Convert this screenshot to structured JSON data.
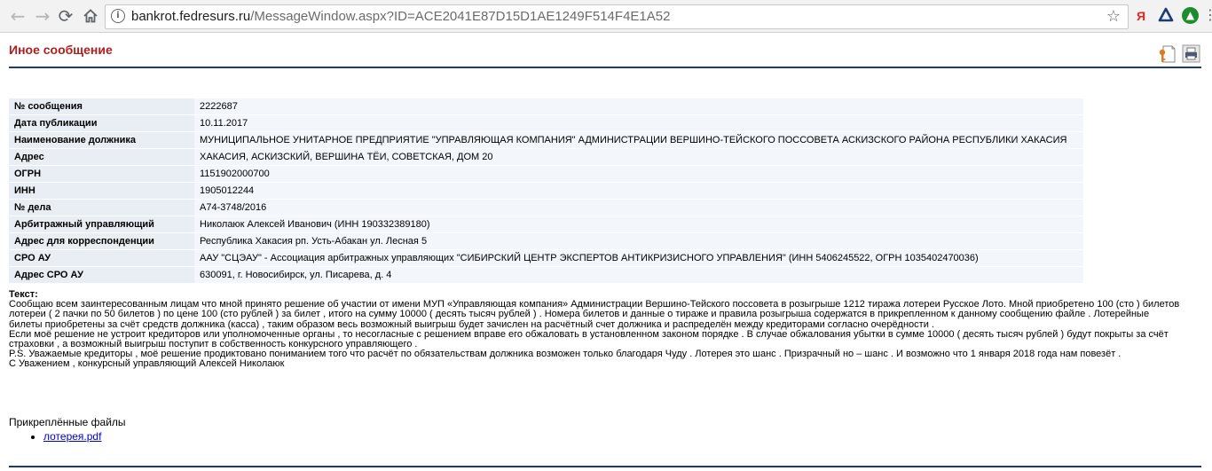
{
  "browser": {
    "back_icon": "arrow-left",
    "forward_icon": "arrow-right",
    "reload_icon": "reload",
    "home_icon": "home",
    "url_host": "bankrot.fedresurs.ru",
    "url_path": "/MessageWindow.aspx?ID=ACE2041E87D15D1AE1249F514F4E1A52",
    "extension_ya_label": "Я",
    "colors": {
      "toolbar": "#f2f2f2",
      "yandex_red": "#e52620",
      "ext_green": "#1c8c2e"
    }
  },
  "page": {
    "title": "Иное сообщение",
    "title_color": "#b01e1e",
    "rule_color": "#1e3a6e"
  },
  "details": [
    {
      "label": "№ сообщения",
      "value": "2222687"
    },
    {
      "label": "Дата публикации",
      "value": "10.11.2017"
    },
    {
      "label": "Наименование должника",
      "value": "МУНИЦИПАЛЬНОЕ УНИТАРНОЕ ПРЕДПРИЯТИЕ \"УПРАВЛЯЮЩАЯ КОМПАНИЯ\" АДМИНИСТРАЦИИ ВЕРШИНО-ТЕЙСКОГО ПОССОВЕТА АСКИЗСКОГО РАЙОНА РЕСПУБЛИКИ ХАКАСИЯ"
    },
    {
      "label": "Адрес",
      "value": "ХАКАСИЯ, АСКИЗСКИЙ, ВЕРШИНА ТЁИ, СОВЕТСКАЯ, ДОМ 20"
    },
    {
      "label": "ОГРН",
      "value": "1151902000700"
    },
    {
      "label": "ИНН",
      "value": "1905012244"
    },
    {
      "label": "№ дела",
      "value": "А74-3748/2016"
    },
    {
      "label": "Арбитражный управляющий",
      "value": "Николаюк Алексей Иванович (ИНН 190332389180)"
    },
    {
      "label": "Адрес для корреспонденции",
      "value": "Республика Хакасия рп. Усть-Абакан ул. Лесная 5"
    },
    {
      "label": "СРО АУ",
      "value": "ААУ \"СЦЭАУ\" - Ассоциация арбитражных управляющих \"СИБИРСКИЙ ЦЕНТР ЭКСПЕРТОВ АНТИКРИЗИСНОГО УПРАВЛЕНИЯ\" (ИНН 5406245522,  ОГРН 1035402470036)"
    },
    {
      "label": "Адрес СРО АУ",
      "value": "630091, г. Новосибирск, ул. Писарева, д. 4"
    }
  ],
  "message": {
    "label": "Текст:",
    "lines": [
      "Сообщаю всем заинтересованным лицам что мной принято решение об участии от имени МУП «Управляющая компания» Администрации Вершино-Тейского поссовета в розыгрыше 1212 тиража лотереи Русское Лото. Мной приобретено 100 (сто ) билетов",
      "лотереи ( 2 пачки по 50 билетов ) по цене 100 (сто рублей ) за билет , итого на сумму 10000 ( десять тысяч рублей ) . Номера билетов и данные о тираже и правила розыгрыша содержатся в прикрепленном к данному сообщению файле . Лотерейные",
      "билеты приобретены за счёт средств должника (касса) , таким образом весь возможный выигрыш будет зачислен на расчётный счет должника и распределён между кредиторами согласно очерёдности .",
      "Если моё решение не устроит кредиторов или уполномоченные органы , то несогласные с решением вправе его обжаловать в установленном законом порядке . В случае обжалования убытки в сумме 10000 ( десять тысяч рублей ) будут покрыты за счёт",
      "страховки , а возможный выигрыш поступит в собственность конкурсного управляющего .",
      "P.S. Уважаемые кредиторы , моё решение продиктовано пониманием того что расчёт по обязательствам должника возможен только благодаря Чуду . Лотерея это шанс . Призрачный но – шанс . И возможно что 1 января 2018 года нам повезёт .",
      "С Уважением , конкурсный управляющий Алексей Николаюк"
    ]
  },
  "attachments": {
    "title": "Прикреплённые файлы",
    "files": [
      {
        "name": "лотерея.pdf"
      }
    ],
    "link_color": "#0000cc"
  }
}
